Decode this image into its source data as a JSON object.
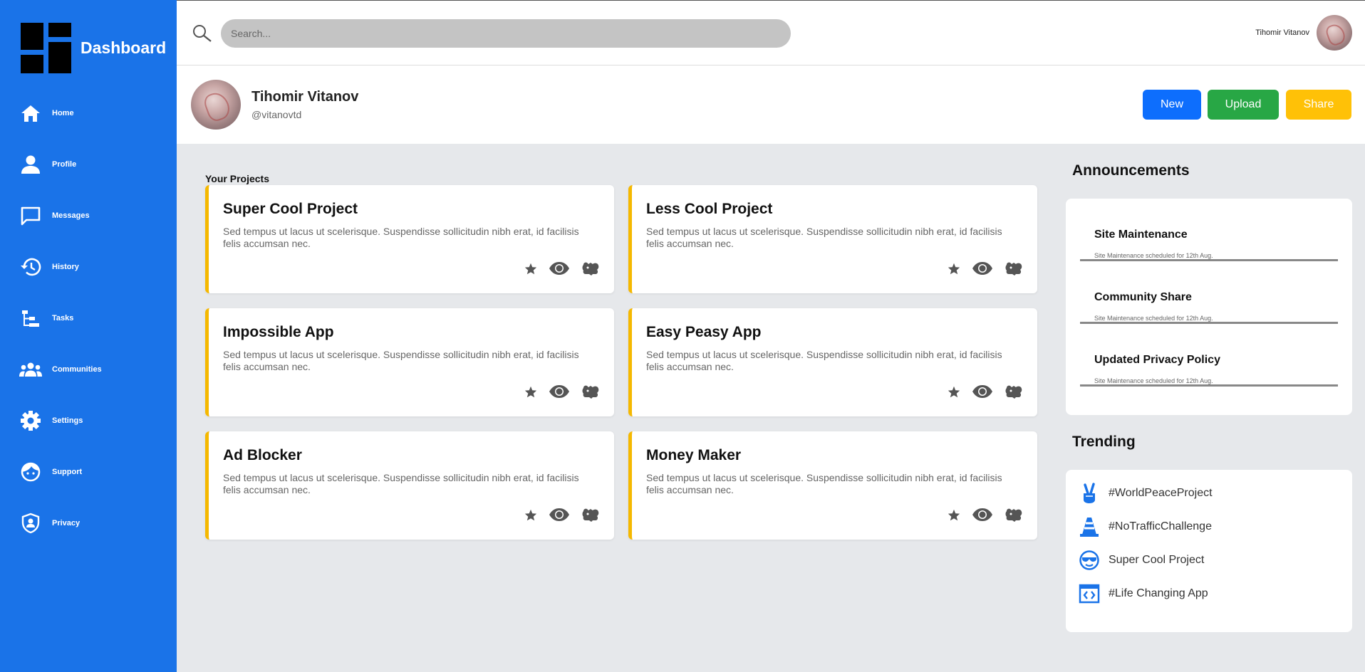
{
  "sidebar": {
    "brand": "Dashboard",
    "items": [
      {
        "label": "Home",
        "icon": "home-icon"
      },
      {
        "label": "Profile",
        "icon": "profile-icon"
      },
      {
        "label": "Messages",
        "icon": "messages-icon"
      },
      {
        "label": "History",
        "icon": "history-icon"
      },
      {
        "label": "Tasks",
        "icon": "tasks-icon"
      },
      {
        "label": "Communities",
        "icon": "communities-icon"
      },
      {
        "label": "Settings",
        "icon": "settings-icon"
      },
      {
        "label": "Support",
        "icon": "support-icon"
      },
      {
        "label": "Privacy",
        "icon": "privacy-icon"
      }
    ]
  },
  "topbar": {
    "search_placeholder": "Search...",
    "user_name": "Tihomir Vitanov"
  },
  "profile": {
    "name": "Tihomir Vitanov",
    "handle": "@vitanovtd",
    "buttons": {
      "new": "New",
      "upload": "Upload",
      "share": "Share"
    }
  },
  "projects": {
    "title": "Your Projects",
    "items": [
      {
        "title": "Super Cool Project",
        "desc": "Sed tempus ut lacus ut scelerisque. Suspendisse sollicitudin nibh erat, id facilisis felis accumsan nec."
      },
      {
        "title": "Less Cool Project",
        "desc": "Sed tempus ut lacus ut scelerisque. Suspendisse sollicitudin nibh erat, id facilisis felis accumsan nec."
      },
      {
        "title": "Impossible App",
        "desc": "Sed tempus ut lacus ut scelerisque. Suspendisse sollicitudin nibh erat, id facilisis felis accumsan nec."
      },
      {
        "title": "Easy Peasy App",
        "desc": "Sed tempus ut lacus ut scelerisque. Suspendisse sollicitudin nibh erat, id facilisis felis accumsan nec."
      },
      {
        "title": "Ad Blocker",
        "desc": "Sed tempus ut lacus ut scelerisque. Suspendisse sollicitudin nibh erat, id facilisis felis accumsan nec."
      },
      {
        "title": "Money Maker",
        "desc": "Sed tempus ut lacus ut scelerisque. Suspendisse sollicitudin nibh erat, id facilisis felis accumsan nec."
      }
    ]
  },
  "announcements": {
    "title": "Announcements",
    "items": [
      {
        "title": "Site Maintenance",
        "sub": "Site Maintenance scheduled for 12th Aug."
      },
      {
        "title": "Community Share",
        "sub": "Site Maintenance scheduled for 12th Aug."
      },
      {
        "title": "Updated Privacy Policy",
        "sub": "Site Maintenance scheduled for 12th Aug."
      }
    ]
  },
  "trending": {
    "title": "Trending",
    "items": [
      {
        "label": "#WorldPeaceProject",
        "icon": "peace-hand-icon"
      },
      {
        "label": "#NoTrafficChallenge",
        "icon": "traffic-cone-icon"
      },
      {
        "label": "Super Cool Project",
        "icon": "sunglasses-face-icon"
      },
      {
        "label": "#Life Changing App",
        "icon": "code-window-icon"
      }
    ]
  },
  "colors": {
    "sidebar": "#1a73e8",
    "accent_border": "#f5b800",
    "btn_new": "#0d6efd",
    "btn_upload": "#28a745",
    "btn_share": "#ffc107"
  }
}
